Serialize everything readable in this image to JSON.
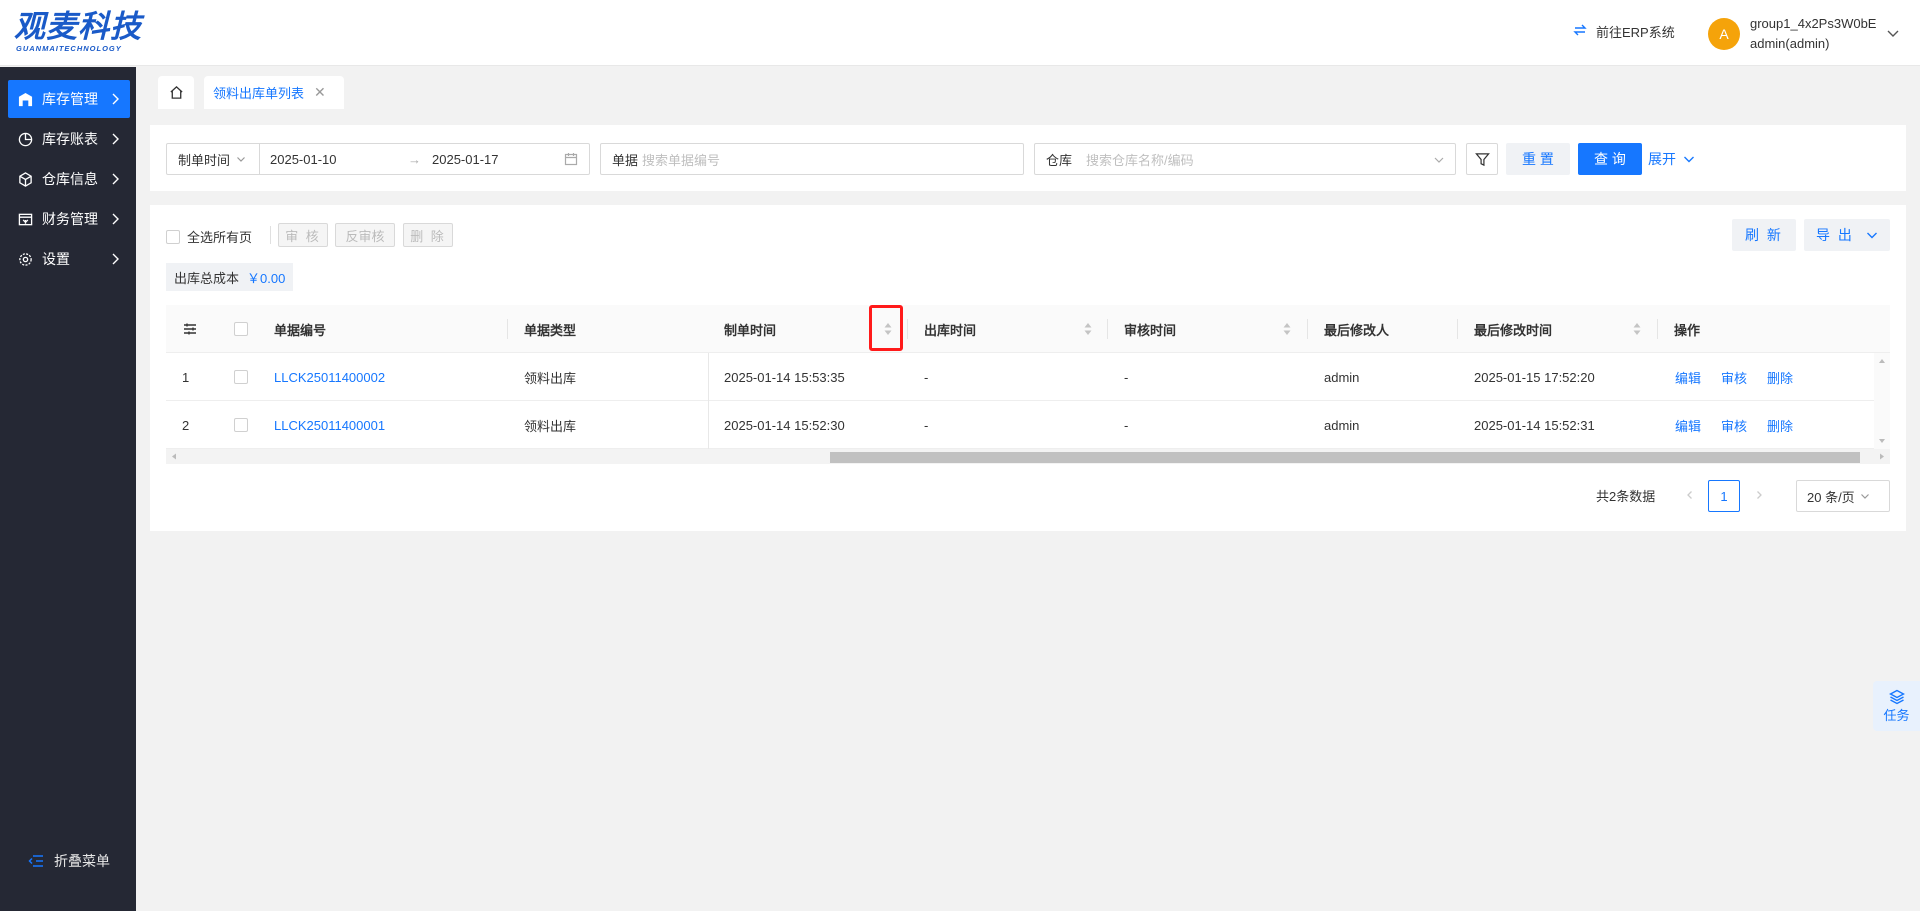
{
  "header": {
    "logo_main": "观麦科技",
    "logo_sub": "GUANMAITECHNOLOGY",
    "erp_link": "前往ERP系统",
    "avatar_letter": "A",
    "user_group": "group1_4x2Ps3W0bE",
    "user_name": "admin(admin)"
  },
  "sidebar": {
    "items": [
      {
        "label": "库存管理",
        "icon": "warehouse-icon",
        "active": true
      },
      {
        "label": "库存账表",
        "icon": "pie-chart-icon"
      },
      {
        "label": "仓库信息",
        "icon": "cube-icon"
      },
      {
        "label": "财务管理",
        "icon": "finance-icon"
      },
      {
        "label": "设置",
        "icon": "gear-icon"
      }
    ],
    "collapse_label": "折叠菜单"
  },
  "tabs": {
    "home_icon": "home-icon",
    "active_tab": "领料出库单列表"
  },
  "filters": {
    "date_type": "制单时间",
    "date_start": "2025-01-10",
    "date_end": "2025-01-17",
    "doc_label": "单据",
    "doc_placeholder": "搜索单据编号",
    "warehouse_label": "仓库",
    "warehouse_placeholder": "搜索仓库名称/编码",
    "reset_label": "重 置",
    "query_label": "查 询",
    "expand_label": "展开"
  },
  "toolbar": {
    "select_all_label": "全选所有页",
    "approve_label": "审 核",
    "unapprove_label": "反审核",
    "delete_label": "删 除",
    "refresh_label": "刷 新",
    "export_label": "导 出"
  },
  "summary": {
    "label": "出库总成本",
    "value": "￥0.00"
  },
  "table": {
    "columns": [
      "单据编号",
      "单据类型",
      "制单时间",
      "出库时间",
      "审核时间",
      "最后修改人",
      "最后修改时间",
      "操作"
    ],
    "rows": [
      {
        "index": "1",
        "doc_no": "LLCK25011400002",
        "type": "领料出库",
        "created": "2025-01-14 15:53:35",
        "out_time": "-",
        "audit_time": "-",
        "modifier": "admin",
        "modified": "2025-01-15 17:52:20"
      },
      {
        "index": "2",
        "doc_no": "LLCK25011400001",
        "type": "领料出库",
        "created": "2025-01-14 15:52:30",
        "out_time": "-",
        "audit_time": "-",
        "modifier": "admin",
        "modified": "2025-01-14 15:52:31"
      }
    ],
    "actions": {
      "edit": "编辑",
      "approve": "审核",
      "delete": "删除"
    }
  },
  "pagination": {
    "total_text": "共2条数据",
    "current_page": "1",
    "page_size": "20 条/页"
  },
  "float": {
    "task_label": "任务"
  },
  "colors": {
    "primary": "#1677ff",
    "sidebar_bg": "#252834",
    "avatar_bg": "#f5a30a",
    "highlight": "#ff1a1a"
  }
}
